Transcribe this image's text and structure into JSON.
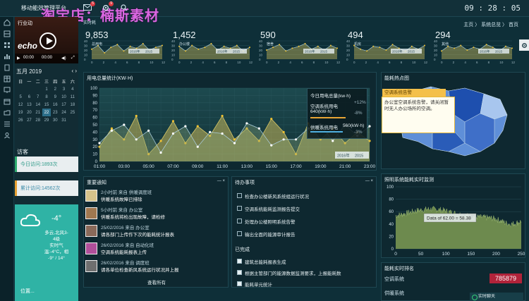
{
  "header": {
    "app_title": "移动能效管理平台",
    "watermark": "淘宝店：楠斯素材",
    "clock": "09 : 28 : 05",
    "icons": [
      {
        "name": "mail-icon",
        "badge": "5"
      },
      {
        "name": "gear-icon",
        "badge": "9"
      },
      {
        "name": "search-icon",
        "badge": ""
      }
    ],
    "realtime_label": "实时耗"
  },
  "breadcrumb": "主页  〉 系统总览  〉 首页",
  "left": {
    "video": {
      "label": "行业动",
      "logo": "echo",
      "time_start": "00:00",
      "time_end": "00:00"
    },
    "calendar": {
      "month": "五月",
      "year": "2019",
      "weekdays": [
        "日",
        "一",
        "二",
        "三",
        "四",
        "五",
        "六"
      ],
      "today": "22"
    },
    "visits_title": "访客",
    "visit_today": "今日访问:1893次",
    "visit_total": "累计访问:14562次",
    "weather": {
      "temp": "-4°",
      "line1": "多云,北风3-",
      "line2": "4级",
      "line3": "实时气",
      "line4": "温:-4°C，相",
      "line5": "-9° / 14°",
      "location": "位置..."
    }
  },
  "kpis": [
    {
      "value": "9,853",
      "label": "总用电"
    },
    {
      "value": "1,452",
      "label": "办公楼"
    },
    {
      "value": "590",
      "label": "宿舍"
    },
    {
      "value": "494",
      "label": "机房"
    },
    {
      "value": "294",
      "label": "其他"
    }
  ],
  "kpi_axis": {
    "ticks_y": [
      "40",
      "30",
      "20",
      "10",
      "0"
    ],
    "ticks_x": [
      "0",
      "2",
      "4",
      "6",
      "8",
      "10",
      "12"
    ],
    "legend": [
      "2016年",
      "2015"
    ]
  },
  "main_chart": {
    "title": "用电总量统计(KW·H)",
    "tools": "",
    "tooltip": {
      "title": "今日用电总量(kw·h)",
      "item1_name": "空调系统用电",
      "item1_value": "640(kW·h)",
      "item1_change": "+12%",
      "item1_change2": "-8%",
      "item2_name": "供暖系统用电",
      "item2_value": "560(kW·h)",
      "item2_change": "-3%"
    },
    "legend": [
      "2016年",
      "2015"
    ]
  },
  "chart_data": {
    "type": "area",
    "title": "用电总量统计(KW·H)",
    "x": [
      "01:00",
      "02:00",
      "03:00",
      "04:00",
      "05:00",
      "06:00",
      "07:00",
      "08:00",
      "09:00",
      "10:00",
      "11:00",
      "12:00",
      "13:00",
      "14:00",
      "15:00",
      "16:00",
      "17:00",
      "18:00",
      "19:00",
      "20:00",
      "21:00",
      "22:00",
      "23:00"
    ],
    "x_tick_labels": [
      "01:00",
      "03:00",
      "05:00",
      "07:00",
      "09:00",
      "11:00",
      "13:00",
      "15:00",
      "17:00",
      "19:00",
      "21:00",
      "23:00"
    ],
    "ylim": [
      0,
      100
    ],
    "y_ticks": [
      0,
      10,
      20,
      30,
      40,
      50,
      60,
      70,
      80,
      90,
      100
    ],
    "series": [
      {
        "name": "2016年",
        "color": "#c8b85a",
        "values": [
          20,
          45,
          30,
          62,
          10,
          28,
          55,
          25,
          48,
          35,
          62,
          30,
          45,
          28,
          58,
          40,
          10,
          52,
          30,
          45,
          25,
          40,
          28
        ]
      },
      {
        "name": "2015",
        "color": "#9fc4d4",
        "values": [
          25,
          42,
          50,
          30,
          42,
          12,
          38,
          48,
          20,
          40,
          38,
          25,
          52,
          45,
          22,
          30,
          30,
          45,
          50,
          28,
          50,
          35,
          48
        ]
      }
    ],
    "grid": true,
    "legend_position": "bottom-right"
  },
  "map": {
    "title": "能耗热点图",
    "tip_head": "空调系统告警",
    "tip_text": "办公室空调系统告警，请关闭暂时无人办公场所的空调。"
  },
  "notices": {
    "title": "重要通知",
    "items": [
      {
        "meta": "2小时前 来自 供暖调度班",
        "text": "供暖系统故障已排除",
        "color": "#d6c38a"
      },
      {
        "meta": "5小时前 来自 办公室",
        "text": "供暖系统将检出现故障，请检修",
        "color": "#a07850"
      },
      {
        "meta": "25/02/2016 来自 办公室",
        "text": "请各部门上传作下次的能耗统计报表",
        "color": "#8a6a5a"
      },
      {
        "meta": "26/02/2016 来自 自动化班",
        "text": "空调系统能耗报表上传",
        "color": "#b04f9a"
      },
      {
        "meta": "26/02/2016 来自 调度班",
        "text": "请各单位检查新风系统运行状况并上报",
        "color": "#6f6f6f"
      }
    ],
    "see_all": "查看所有"
  },
  "todo": {
    "title": "待办事项",
    "items": [
      "检查办公楼新风系统组运行状况",
      "空调系统能耗监测报告提交",
      "处理办公楼照明系统告警",
      "输出全面的能源审计报告"
    ],
    "done_title": "已完成",
    "done": [
      "建筑总能耗报表生成",
      "根据主管部门的能源数据监测要求，上报能耗数",
      "能耗单元统计"
    ]
  },
  "area_chart": {
    "title": "照明系统能耗实时监测",
    "tooltip": "Data of 62.00 = 58.38",
    "y_ticks": [
      "100",
      "80",
      "60",
      "40",
      "20",
      "0"
    ],
    "x_ticks": [
      "0",
      "50",
      "100",
      "150",
      "200",
      "250"
    ]
  },
  "rank": {
    "title": "能耗实时排名",
    "row1_label": "空调系统",
    "row1_value": "785879",
    "row2_label": "供暖系统",
    "status": "实时聊天"
  }
}
